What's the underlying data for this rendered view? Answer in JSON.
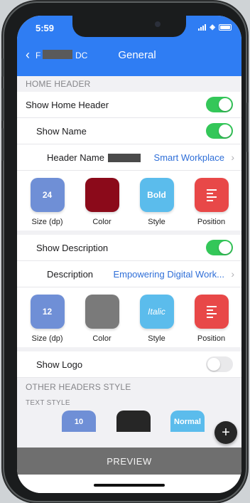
{
  "status": {
    "time": "5:59"
  },
  "nav": {
    "back_label": "F",
    "back_suffix": "DC",
    "title": "General"
  },
  "home_header": {
    "section_title": "HOME HEADER",
    "show_home_header": "Show Home Header",
    "show_name": "Show Name",
    "header_name_label": "Header Name",
    "header_name_value": "Smart Workplace",
    "name_tiles": [
      {
        "value": "24",
        "caption": "Size (dp)",
        "color": "#6f8fd6"
      },
      {
        "value": "",
        "caption": "Color",
        "color": "#8b0a1a"
      },
      {
        "value": "Bold",
        "caption": "Style",
        "color": "#5bbcec"
      },
      {
        "value": "",
        "caption": "Position",
        "color": "#e84848"
      }
    ],
    "show_description": "Show Description",
    "description_label": "Description",
    "description_value": "Empowering Digital Work...",
    "desc_tiles": [
      {
        "value": "12",
        "caption": "Size (dp)",
        "color": "#6f8fd6"
      },
      {
        "value": "",
        "caption": "Color",
        "color": "#7a7a7a"
      },
      {
        "value": "Italic",
        "caption": "Style",
        "color": "#5bbcec"
      },
      {
        "value": "",
        "caption": "Position",
        "color": "#e84848"
      }
    ],
    "show_logo": "Show Logo"
  },
  "other_headers": {
    "section_title": "OTHER HEADERS STYLE",
    "text_style_title": "TEXT STYLE",
    "partial_tiles": [
      "10",
      "",
      "Normal"
    ]
  },
  "fab": {
    "label": "+"
  },
  "preview": {
    "label": "PREVIEW"
  },
  "colors": {
    "accent": "#2f7df3",
    "toggle_on": "#34c759",
    "link": "#2f6fd8"
  }
}
